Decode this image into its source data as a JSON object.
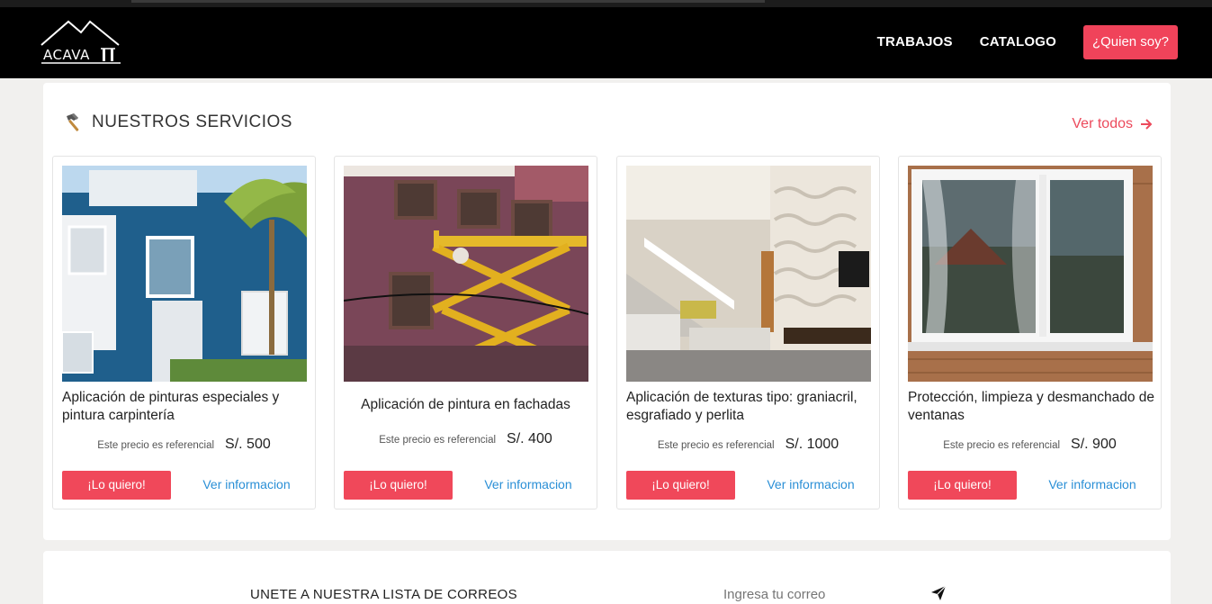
{
  "header": {
    "logo_text": "ACAVA",
    "nav": [
      {
        "label": "TRABAJOS"
      },
      {
        "label": "CATALOGO"
      }
    ],
    "cta_label": "¿Quien soy?"
  },
  "services": {
    "title": "NUESTROS SERVICIOS",
    "title_icon": "hammer-icon",
    "see_all": "Ver todos",
    "cards": [
      {
        "title": "Aplicación de pinturas especiales y pintura carpintería",
        "ref_label": "Este precio es referencial",
        "price": "S/. 500",
        "button": "¡Lo quiero!",
        "info": "Ver informacion"
      },
      {
        "title": "Aplicación de pintura en fachadas",
        "ref_label": "Este precio es referencial",
        "price": "S/. 400",
        "button": "¡Lo quiero!",
        "info": "Ver informacion"
      },
      {
        "title": "Aplicación de texturas tipo: graniacril, esgrafiado y perlita",
        "ref_label": "Este precio es referencial",
        "price": "S/. 1000",
        "button": "¡Lo quiero!",
        "info": "Ver informacion"
      },
      {
        "title": "Protección, limpieza y desmanchado de ventanas",
        "ref_label": "Este precio es referencial",
        "price": "S/. 900",
        "button": "¡Lo quiero!",
        "info": "Ver informacion"
      }
    ]
  },
  "newsletter": {
    "label": "UNETE A NUESTRA LISTA DE CORREOS",
    "placeholder": "Ingresa tu correo",
    "send_icon": "paper-plane-icon"
  },
  "colors": {
    "accent": "#f0435a",
    "link": "#2a8fd6",
    "header_bg": "#000000"
  }
}
